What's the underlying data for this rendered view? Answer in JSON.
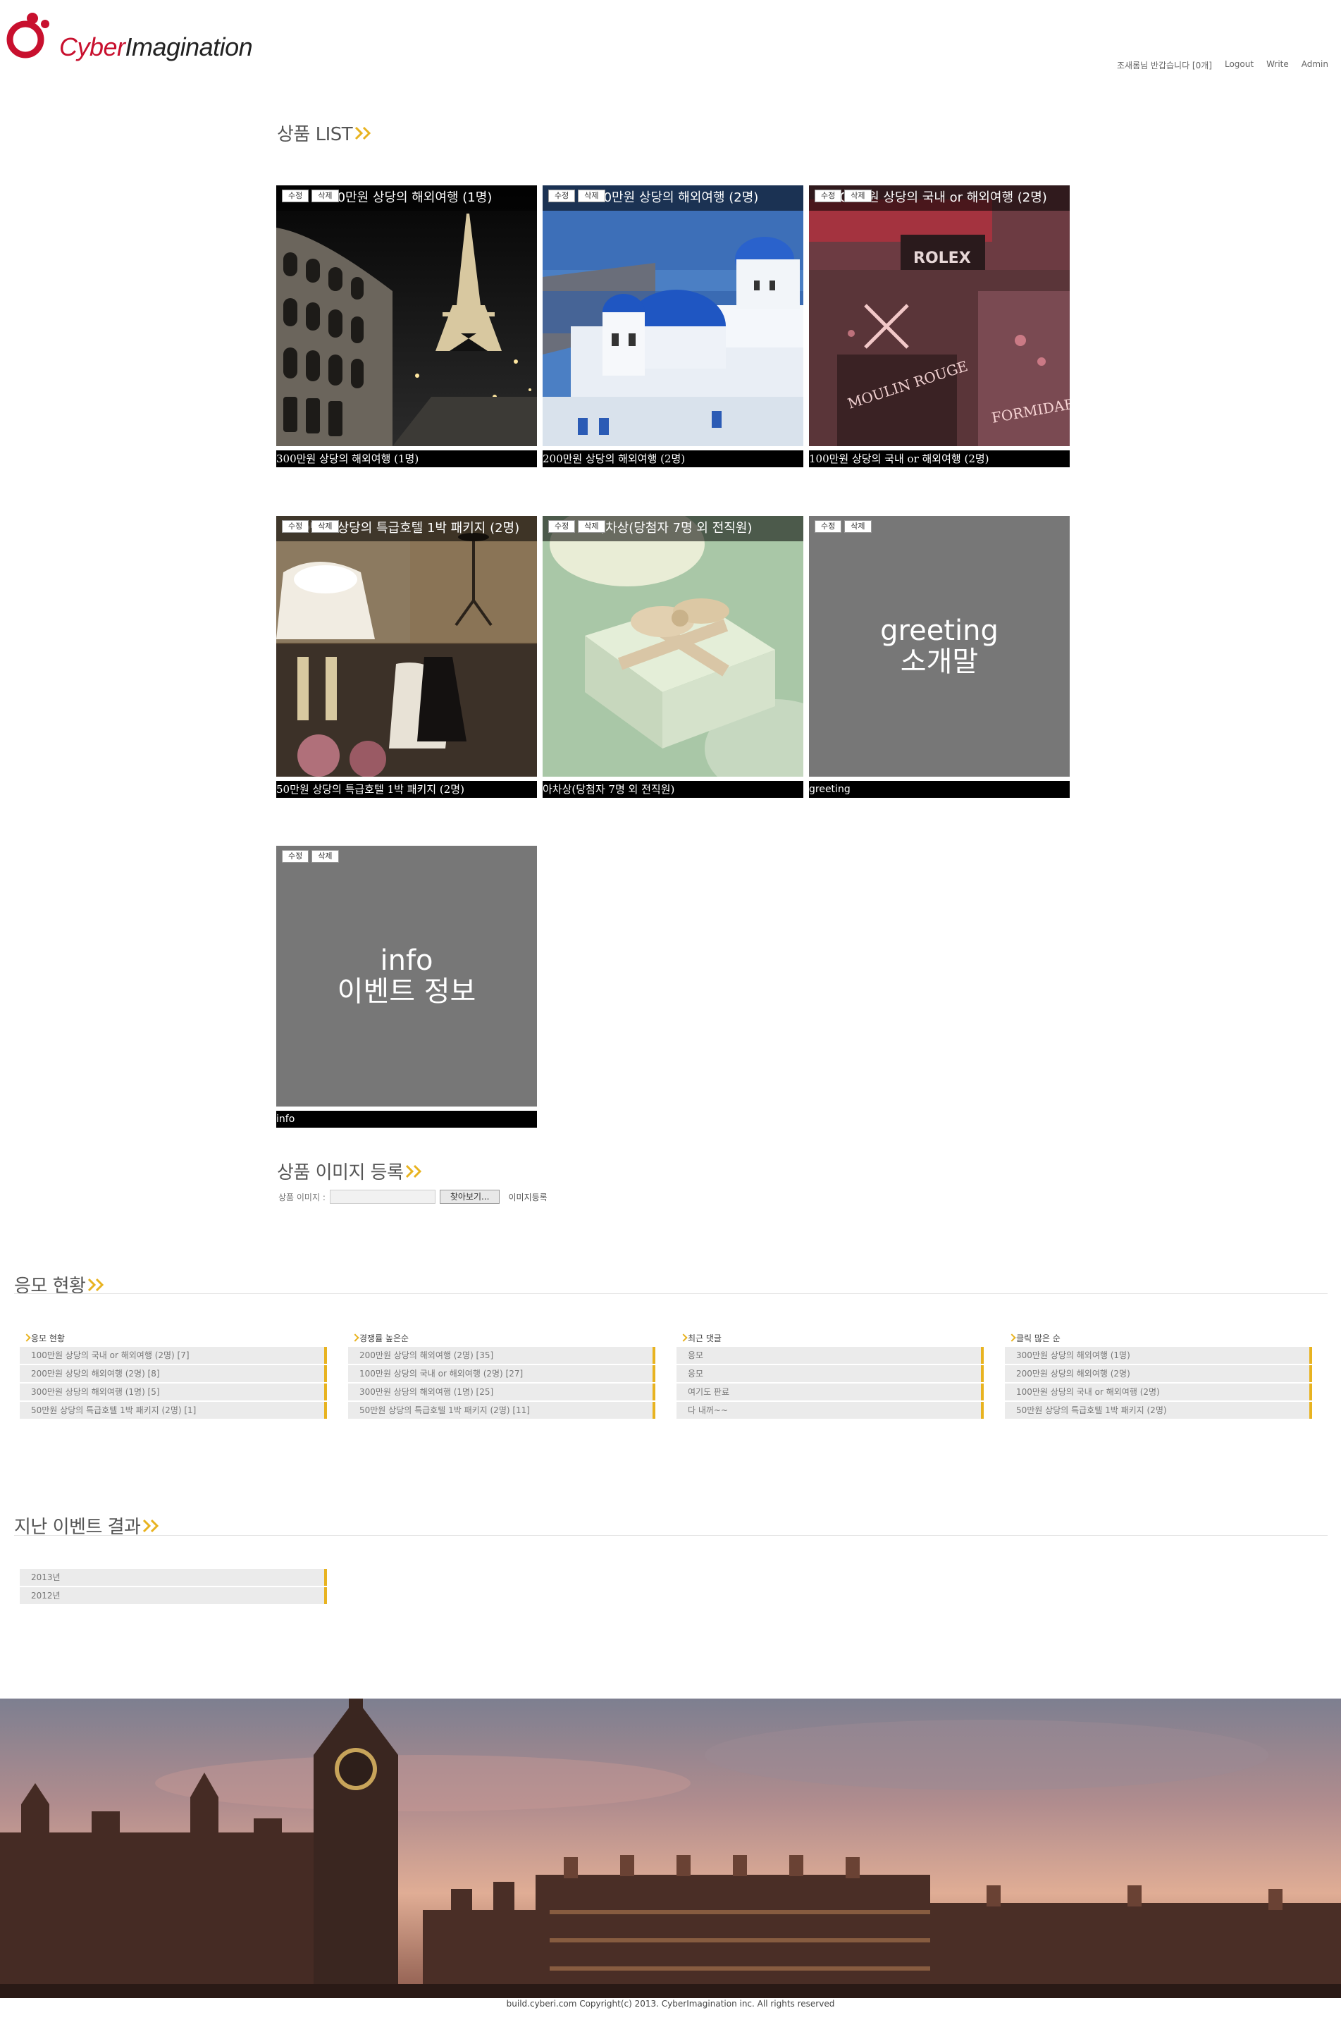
{
  "header": {
    "logo_cyber": "Cyber",
    "logo_imagination": "Imagination",
    "welcome": "조새롬님 반갑습니다 [0개]",
    "logout": "Logout",
    "write": "Write",
    "admin": "Admin"
  },
  "product_list": {
    "title": "상품 LIST",
    "edit_label": "수정",
    "delete_label": "삭제",
    "items": [
      {
        "overlay": "300만원 상당의 해외여행 (1명)",
        "caption": "300만원 상당의 해외여행 (1명)",
        "image": "paris-colosseum-night"
      },
      {
        "overlay": "200만원 상당의 해외여행 (2명)",
        "caption": "200만원 상당의 해외여행 (2명)",
        "image": "santorini-blue-domes"
      },
      {
        "overlay": "100만원 상당의 국내 or 해외여행 (2명)",
        "caption": "100만원 상당의 국내 or 해외여행 (2명)",
        "image": "neon-moulin-rouge"
      },
      {
        "overlay": "50만원 상당의 특급호텔 1박 패키지 (2명)",
        "caption": "50만원 상당의 특급호텔 1박 패키지 (2명)",
        "image": "hotel-room-sepia"
      },
      {
        "overlay": "아차상(당첨자 7명 외 전직원)",
        "caption": "아차상(당첨자 7명 외 전직원)",
        "image": "gift-box-ribbon"
      },
      {
        "label_line1": "greeting",
        "label_line2": "소개말",
        "caption": "greeting",
        "image": "gray-placeholder"
      },
      {
        "label_line1": "info",
        "label_line2": "이벤트 정보",
        "caption": "info",
        "image": "gray-placeholder"
      }
    ]
  },
  "upload": {
    "title": "상품 이미지 등록",
    "label": "상품 이미지 :",
    "browse": "찾아보기...",
    "submit": "이미지등록"
  },
  "status": {
    "title": "응모 현황",
    "columns": [
      {
        "heading": "응모 현황",
        "items": [
          "100만원 상당의 국내 or 해외여행 (2명) [7]",
          "200만원 상당의 해외여행 (2명) [8]",
          "300만원 상당의 해외여행 (1명) [5]",
          "50만원 상당의 특급호텔 1박 패키지 (2명) [1]"
        ]
      },
      {
        "heading": "경쟁률 높은순",
        "items": [
          "200만원 상당의 해외여행 (2명) [35]",
          "100만원 상당의 국내 or 해외여행 (2명) [27]",
          "300만원 상당의 해외여행 (1명) [25]",
          "50만원 상당의 특급호텔 1박 패키지 (2명) [11]"
        ]
      },
      {
        "heading": "최근 댓글",
        "items": [
          "응모",
          "응모",
          "여기도 판료",
          "다 내꺼~~"
        ]
      },
      {
        "heading": "클릭 많은 순",
        "items": [
          "300만원 상당의 해외여행 (1명)",
          "200만원 상당의 해외여행 (2명)",
          "100만원 상당의 국내 or 해외여행 (2명)",
          "50만원 상당의 특급호텔 1박 패키지 (2명)"
        ]
      }
    ]
  },
  "past_events": {
    "title": "지난 이벤트 결과",
    "items": [
      "2013년",
      "2012년"
    ]
  },
  "footer": {
    "image": "london-skyline-sunset",
    "copyright": "build.cyberi.com Copyright(c) 2013. CyberImagination inc. All rights reserved"
  },
  "colors": {
    "accent_yellow": "#e8b320",
    "brand_red": "#c8102e",
    "placeholder_gray": "#757575"
  }
}
